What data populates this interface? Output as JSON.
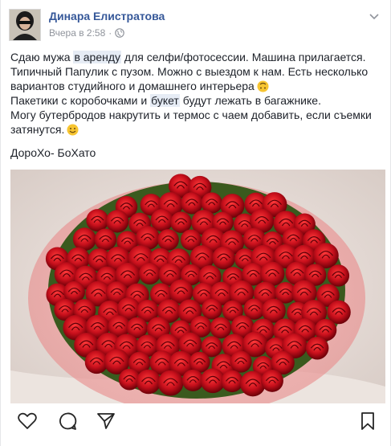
{
  "post": {
    "author_name": "Динара Елистратова",
    "timestamp": "Вчера в 2:58",
    "privacy_icon": "globe-icon",
    "menu_icon": "chevron-down-icon",
    "text": {
      "l1_a": "Сдаю мужа ",
      "l1_link": "в аренду",
      "l1_b": " для селфи/фотосессии. Машина прилагается.",
      "l2": "Типичный Папулик с пузом. Можно с выездом к нам. Есть несколько вариантов студийного и домашнего интерьера",
      "l3_a": "Пакетики с коробочками и ",
      "l3_link": "букет",
      "l3_b": " будут лежать в багажнике.",
      "l4": "Могу бутербродов накрутить и термос с чаем добавить, если съемки затянутся."
    },
    "emojis": [
      "upside-down-face-emoji",
      "smile-emoji"
    ],
    "signature": "ДороХо- БоХато",
    "photo_subject": "rose-bouquet-photo",
    "action_icons": [
      "heart-icon",
      "comment-icon",
      "share-icon",
      "bookmark-icon"
    ],
    "colors": {
      "author": "#365899",
      "meta": "#90949c",
      "text": "#1d2129",
      "link_highlight": "#e6ecf5",
      "rose": "#c0121c"
    }
  }
}
